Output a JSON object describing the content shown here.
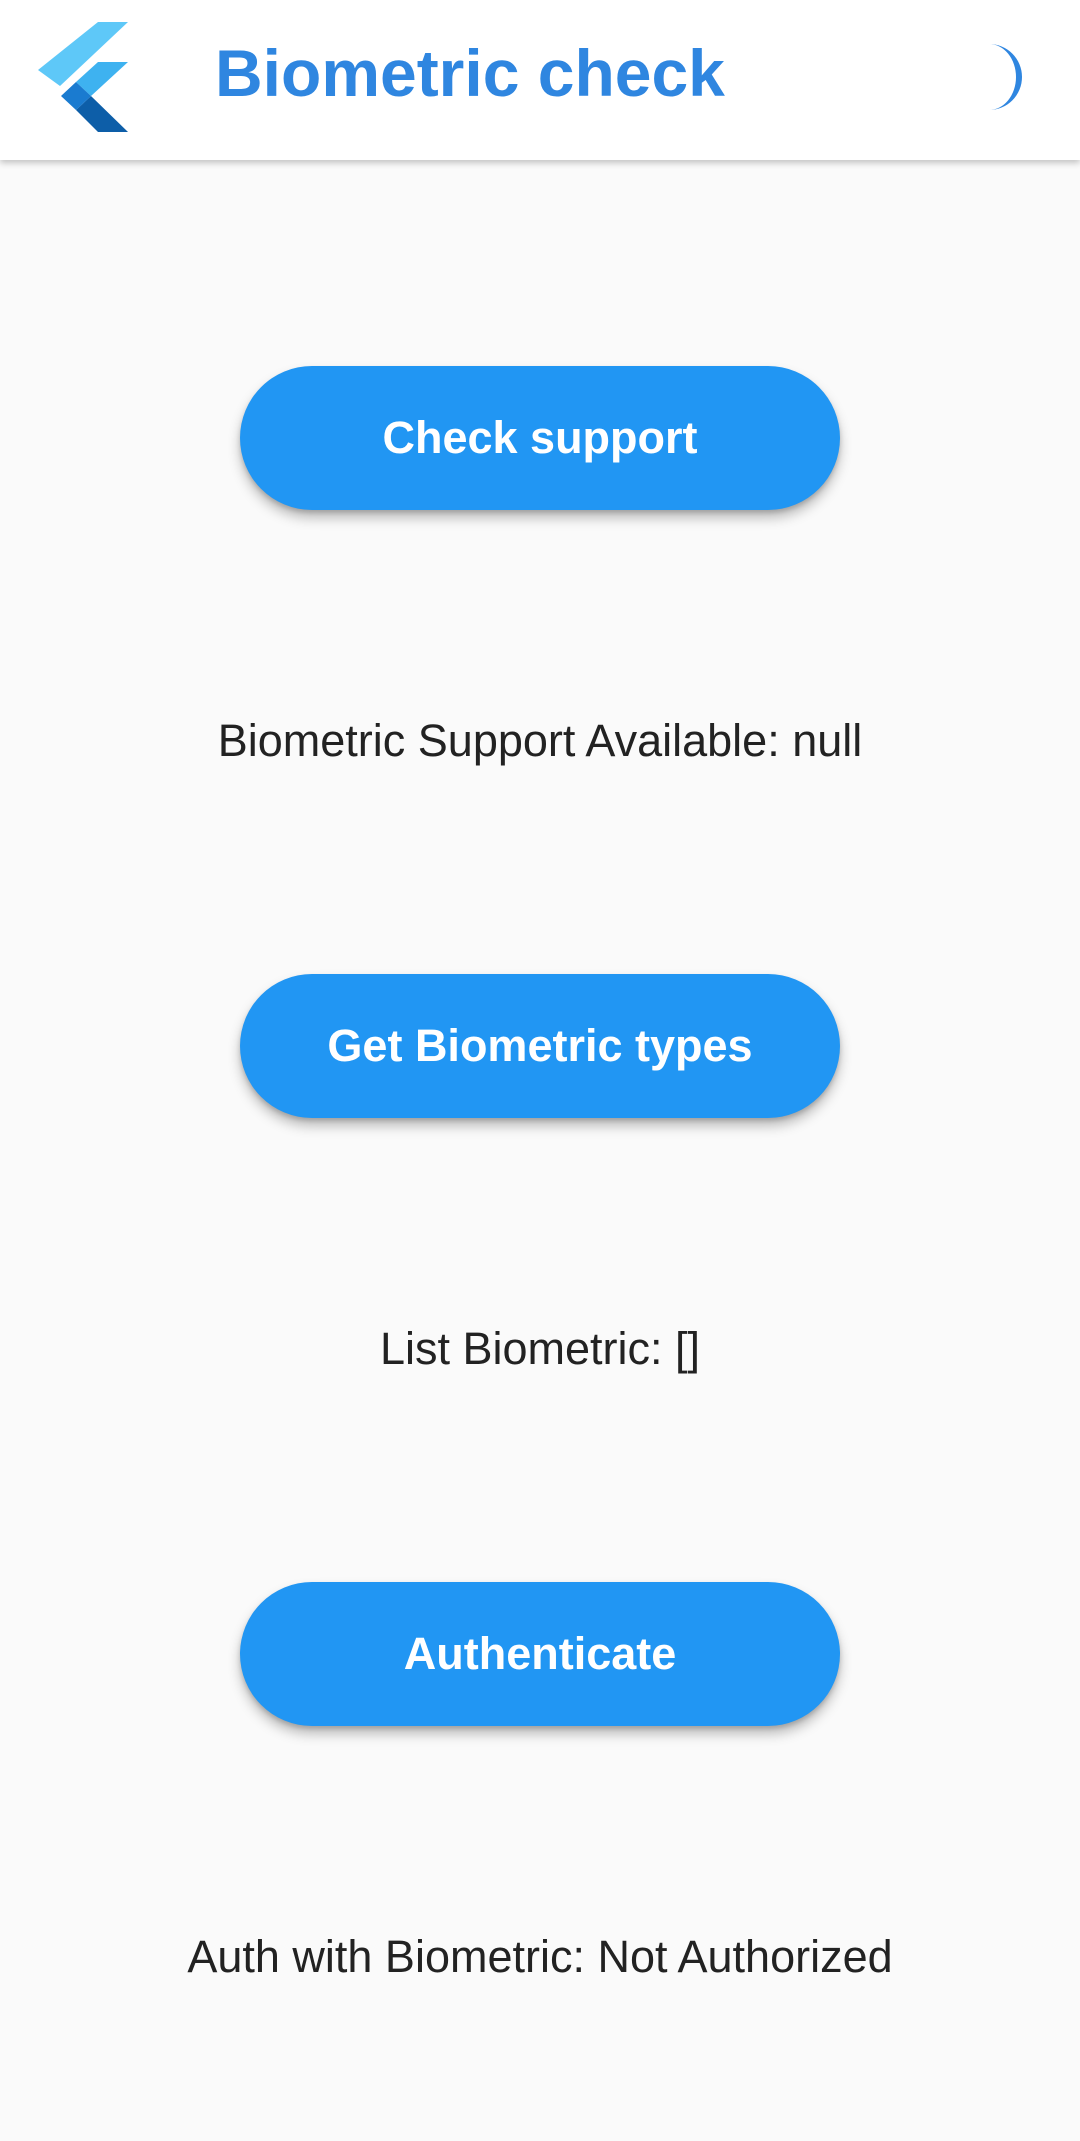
{
  "app_bar": {
    "title": "Biometric check",
    "logo_icon": "flutter-logo",
    "theme_icon": "moon-icon",
    "title_color": "#2f86e0"
  },
  "actions": {
    "check_support_label": "Check support",
    "get_types_label": "Get Biometric types",
    "authenticate_label": "Authenticate",
    "button_color": "#2196f3"
  },
  "results": {
    "support_text": "Biometric Support Available: null",
    "types_text": "List Biometric: []",
    "auth_text": "Auth with Biometric: Not Authorized"
  }
}
